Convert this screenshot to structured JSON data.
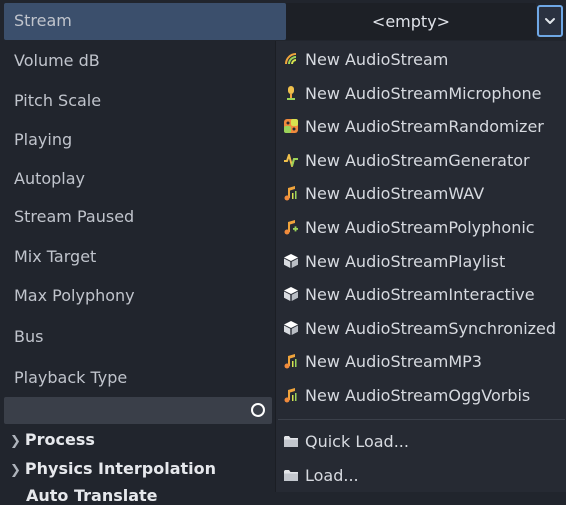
{
  "inspector": {
    "properties": [
      {
        "label": "Stream"
      },
      {
        "label": "Volume dB"
      },
      {
        "label": "Pitch Scale"
      },
      {
        "label": "Playing"
      },
      {
        "label": "Autoplay"
      },
      {
        "label": "Stream Paused"
      },
      {
        "label": "Mix Target"
      },
      {
        "label": "Max Polyphony"
      },
      {
        "label": "Bus"
      },
      {
        "label": "Playback Type"
      }
    ],
    "stream_value": "<empty>",
    "sections": [
      {
        "label": "Process"
      },
      {
        "label": "Physics Interpolation"
      },
      {
        "label": "Auto Translate"
      }
    ]
  },
  "menu": {
    "items": [
      {
        "label": "New AudioStream",
        "icon": "audio-stream-icon"
      },
      {
        "label": "New AudioStreamMicrophone",
        "icon": "microphone-icon"
      },
      {
        "label": "New AudioStreamRandomizer",
        "icon": "randomizer-icon"
      },
      {
        "label": "New AudioStreamGenerator",
        "icon": "generator-icon"
      },
      {
        "label": "New AudioStreamWAV",
        "icon": "wav-icon"
      },
      {
        "label": "New AudioStreamPolyphonic",
        "icon": "polyphonic-icon"
      },
      {
        "label": "New AudioStreamPlaylist",
        "icon": "playlist-cube-icon"
      },
      {
        "label": "New AudioStreamInteractive",
        "icon": "interactive-cube-icon"
      },
      {
        "label": "New AudioStreamSynchronized",
        "icon": "synchronized-cube-icon"
      },
      {
        "label": "New AudioStreamMP3",
        "icon": "mp3-icon"
      },
      {
        "label": "New AudioStreamOggVorbis",
        "icon": "ogg-vorbis-icon"
      }
    ],
    "file_actions": [
      {
        "label": "Quick Load...",
        "icon": "folder-icon"
      },
      {
        "label": "Load...",
        "icon": "folder-icon"
      }
    ]
  },
  "colors": {
    "selected_row": "#3b4f6c",
    "accent_focus": "#6fa8e6",
    "panel_bg": "#21252d",
    "menu_bg": "#262a33"
  }
}
